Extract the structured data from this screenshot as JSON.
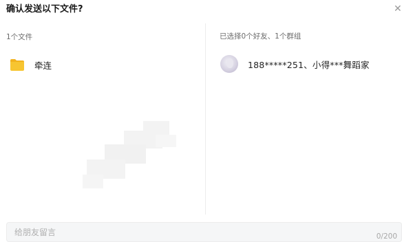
{
  "dialog": {
    "title": "确认发送以下文件?",
    "close_icon": "close-icon"
  },
  "files": {
    "label": "1个文件",
    "items": [
      {
        "name": "牵连",
        "icon": "folder-icon"
      }
    ]
  },
  "recipients": {
    "label": "已选择0个好友、1个群组",
    "items": [
      {
        "name": "188*****251、小得***舞蹈家",
        "icon": "avatar"
      }
    ]
  },
  "message": {
    "placeholder": "给朋友留言",
    "value": "",
    "counter": "0/200"
  },
  "colors": {
    "folder": "#f7c531",
    "divider": "#ececec"
  }
}
